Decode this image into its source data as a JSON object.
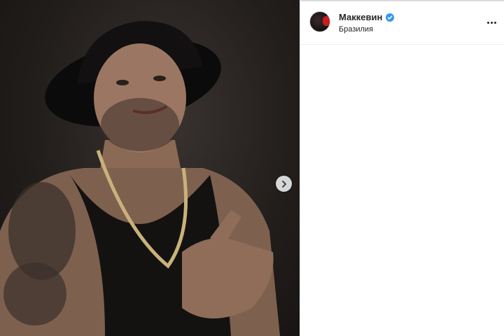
{
  "post": {
    "author": {
      "username": "Маккевин",
      "verified": true,
      "location": "Бразилия"
    },
    "media": {
      "description": "",
      "has_next": true
    },
    "more_options_icon": "more-horizontal-icon",
    "next_icon": "chevron-right-icon",
    "verified_icon": "verified-badge-icon",
    "colors": {
      "verified": "#3897f0",
      "text": "#262626",
      "divider": "#efefef"
    }
  }
}
